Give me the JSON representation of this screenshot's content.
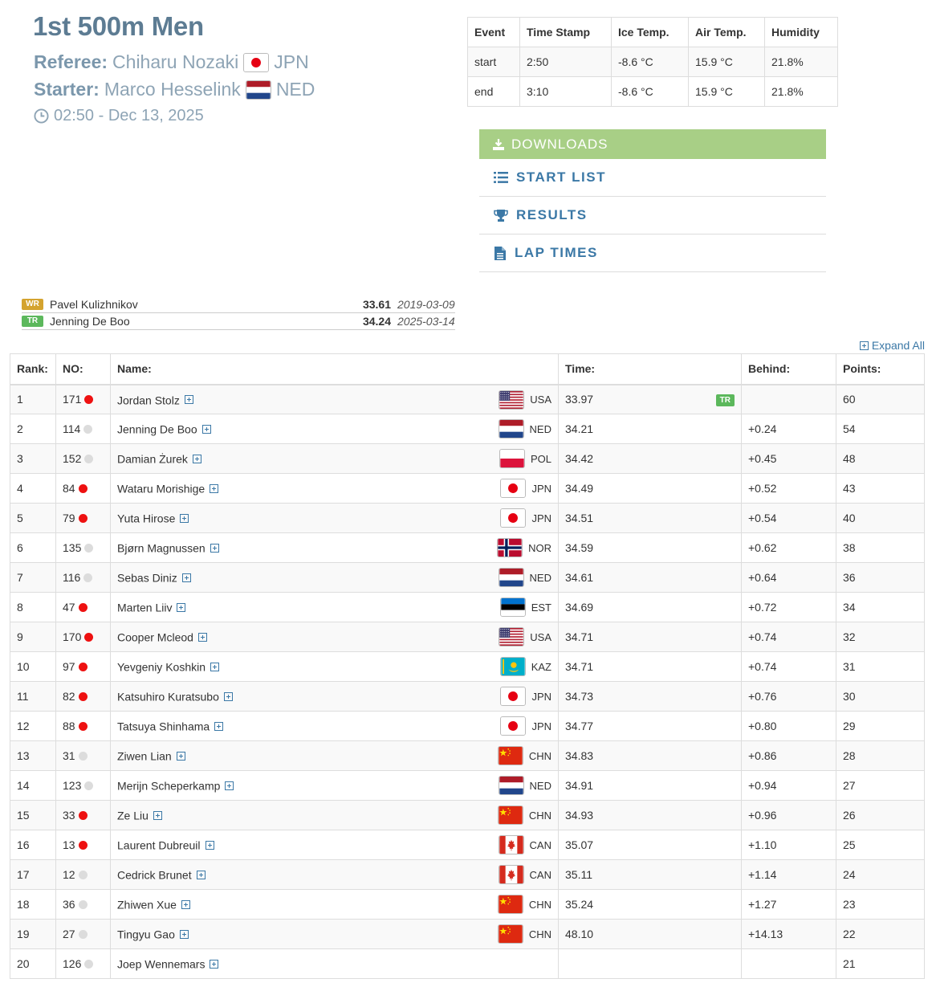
{
  "title": "1st 500m Men",
  "referee": {
    "label": "Referee:",
    "name": "Chiharu Nozaki",
    "nation": "JPN",
    "flag": "JPN"
  },
  "starter": {
    "label": "Starter:",
    "name": "Marco Hesselink",
    "nation": "NED",
    "flag": "NED"
  },
  "datetime": "02:50 - Dec 13, 2025",
  "conditions": {
    "headers": [
      "Event",
      "Time Stamp",
      "Ice Temp.",
      "Air Temp.",
      "Humidity"
    ],
    "rows": [
      [
        "start",
        "2:50",
        "-8.6 °C",
        "15.9 °C",
        "21.8%"
      ],
      [
        "end",
        "3:10",
        "-8.6 °C",
        "15.9 °C",
        "21.8%"
      ]
    ]
  },
  "downloads": {
    "header": "DOWNLOADS",
    "items": [
      {
        "label": "START LIST",
        "icon": "list-icon"
      },
      {
        "label": "RESULTS",
        "icon": "trophy-icon"
      },
      {
        "label": "LAP TIMES",
        "icon": "document-icon"
      }
    ]
  },
  "records": [
    {
      "badge": "WR",
      "name": "Pavel Kulizhnikov",
      "time": "33.61",
      "date": "2019-03-09"
    },
    {
      "badge": "TR",
      "name": "Jenning De Boo",
      "time": "34.24",
      "date": "2025-03-14"
    }
  ],
  "expand_all": "Expand All",
  "results": {
    "headers": {
      "rank": "Rank:",
      "no": "NO:",
      "name": "Name:",
      "time": "Time:",
      "behind": "Behind:",
      "points": "Points:"
    },
    "rows": [
      {
        "rank": "1",
        "no": "171",
        "dot": "red",
        "name": "Jordan Stolz",
        "nation": "USA",
        "time": "33.97",
        "badge": "TR",
        "behind": "",
        "points": "60"
      },
      {
        "rank": "2",
        "no": "114",
        "dot": "grey",
        "name": "Jenning De Boo",
        "nation": "NED",
        "time": "34.21",
        "badge": "",
        "behind": "+0.24",
        "points": "54"
      },
      {
        "rank": "3",
        "no": "152",
        "dot": "grey",
        "name": "Damian Żurek",
        "nation": "POL",
        "time": "34.42",
        "badge": "",
        "behind": "+0.45",
        "points": "48"
      },
      {
        "rank": "4",
        "no": "84",
        "dot": "red",
        "name": "Wataru Morishige",
        "nation": "JPN",
        "time": "34.49",
        "badge": "",
        "behind": "+0.52",
        "points": "43"
      },
      {
        "rank": "5",
        "no": "79",
        "dot": "red",
        "name": "Yuta Hirose",
        "nation": "JPN",
        "time": "34.51",
        "badge": "",
        "behind": "+0.54",
        "points": "40"
      },
      {
        "rank": "6",
        "no": "135",
        "dot": "grey",
        "name": "Bjørn Magnussen",
        "nation": "NOR",
        "time": "34.59",
        "badge": "",
        "behind": "+0.62",
        "points": "38"
      },
      {
        "rank": "7",
        "no": "116",
        "dot": "grey",
        "name": "Sebas Diniz",
        "nation": "NED",
        "time": "34.61",
        "badge": "",
        "behind": "+0.64",
        "points": "36"
      },
      {
        "rank": "8",
        "no": "47",
        "dot": "red",
        "name": "Marten Liiv",
        "nation": "EST",
        "time": "34.69",
        "badge": "",
        "behind": "+0.72",
        "points": "34"
      },
      {
        "rank": "9",
        "no": "170",
        "dot": "red",
        "name": "Cooper Mcleod",
        "nation": "USA",
        "time": "34.71",
        "badge": "",
        "behind": "+0.74",
        "points": "32"
      },
      {
        "rank": "10",
        "no": "97",
        "dot": "red",
        "name": "Yevgeniy Koshkin",
        "nation": "KAZ",
        "time": "34.71",
        "badge": "",
        "behind": "+0.74",
        "points": "31"
      },
      {
        "rank": "11",
        "no": "82",
        "dot": "red",
        "name": "Katsuhiro Kuratsubo",
        "nation": "JPN",
        "time": "34.73",
        "badge": "",
        "behind": "+0.76",
        "points": "30"
      },
      {
        "rank": "12",
        "no": "88",
        "dot": "red",
        "name": "Tatsuya Shinhama",
        "nation": "JPN",
        "time": "34.77",
        "badge": "",
        "behind": "+0.80",
        "points": "29"
      },
      {
        "rank": "13",
        "no": "31",
        "dot": "grey",
        "name": "Ziwen Lian",
        "nation": "CHN",
        "time": "34.83",
        "badge": "",
        "behind": "+0.86",
        "points": "28"
      },
      {
        "rank": "14",
        "no": "123",
        "dot": "grey",
        "name": "Merijn Scheperkamp",
        "nation": "NED",
        "time": "34.91",
        "badge": "",
        "behind": "+0.94",
        "points": "27"
      },
      {
        "rank": "15",
        "no": "33",
        "dot": "red",
        "name": "Ze Liu",
        "nation": "CHN",
        "time": "34.93",
        "badge": "",
        "behind": "+0.96",
        "points": "26"
      },
      {
        "rank": "16",
        "no": "13",
        "dot": "red",
        "name": "Laurent Dubreuil",
        "nation": "CAN",
        "time": "35.07",
        "badge": "",
        "behind": "+1.10",
        "points": "25"
      },
      {
        "rank": "17",
        "no": "12",
        "dot": "grey",
        "name": "Cedrick Brunet",
        "nation": "CAN",
        "time": "35.11",
        "badge": "",
        "behind": "+1.14",
        "points": "24"
      },
      {
        "rank": "18",
        "no": "36",
        "dot": "grey",
        "name": "Zhiwen Xue",
        "nation": "CHN",
        "time": "35.24",
        "badge": "",
        "behind": "+1.27",
        "points": "23"
      },
      {
        "rank": "19",
        "no": "27",
        "dot": "grey",
        "name": "Tingyu Gao",
        "nation": "CHN",
        "time": "48.10",
        "badge": "",
        "behind": "+14.13",
        "points": "22"
      },
      {
        "rank": "20",
        "no": "126",
        "dot": "grey",
        "name": "Joep Wennemars",
        "nation": "",
        "time": "",
        "badge": "",
        "behind": "",
        "points": "21"
      }
    ]
  }
}
